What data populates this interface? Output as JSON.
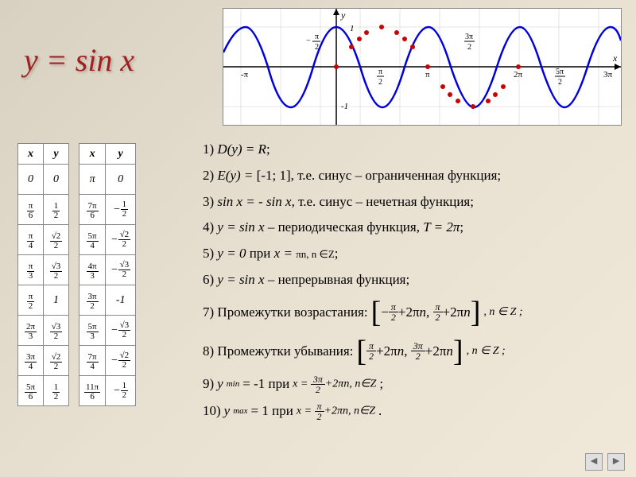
{
  "title": "y = sin x",
  "graph": {
    "xlabel": "x",
    "ylabel": "y",
    "y_ticks": [
      "1",
      "-1"
    ],
    "x_ticks": [
      "-π",
      "−π/2",
      "π/2",
      "π",
      "3π/2",
      "2π",
      "5π/2",
      "3π"
    ]
  },
  "table1": {
    "headers": [
      "x",
      "y"
    ],
    "rows": [
      {
        "x": "0",
        "y": "0"
      },
      {
        "x": "π/6",
        "y": "1/2"
      },
      {
        "x": "π/4",
        "y": "√2/2"
      },
      {
        "x": "π/3",
        "y": "√3/2"
      },
      {
        "x": "π/2",
        "y": "1"
      },
      {
        "x": "2π/3",
        "y": "√3/2"
      },
      {
        "x": "3π/4",
        "y": "√2/2"
      },
      {
        "x": "5π/6",
        "y": "1/2"
      }
    ]
  },
  "table2": {
    "headers": [
      "x",
      "y"
    ],
    "rows": [
      {
        "x": "π",
        "y": "0"
      },
      {
        "x": "7π/6",
        "y": "−1/2"
      },
      {
        "x": "5π/4",
        "y": "−√2/2"
      },
      {
        "x": "4π/3",
        "y": "−√3/2"
      },
      {
        "x": "3π/2",
        "y": "-1"
      },
      {
        "x": "5π/3",
        "y": "−√3/2"
      },
      {
        "x": "7π/4",
        "y": "−√2/2"
      },
      {
        "x": "11π/6",
        "y": "−1/2"
      }
    ]
  },
  "props": {
    "p1_a": "1) ",
    "p1_b": "D(y) = R",
    "p1_c": ";",
    "p2_a": "2) ",
    "p2_b": "E(y) = ",
    "p2_c": "[-1; 1], т.е. синус – ограниченная функция;",
    "p3_a": "3) ",
    "p3_b": "sin x = - sin x",
    "p3_c": ", т.е. синус – нечетная функция;",
    "p4_a": "4) ",
    "p4_b": "y = sin x",
    "p4_c": " – периодическая функция, ",
    "p4_d": "T = 2π",
    "p4_e": ";",
    "p5_a": "5) ",
    "p5_b": "y = 0",
    "p5_c": " при ",
    "p5_d": "x = ",
    "p5_e": "πn, n ∈Z",
    "p5_f": ";",
    "p6_a": "6) ",
    "p6_b": "y = sin x",
    "p6_c": " – непрерывная функция;",
    "p7_a": "7) Промежутки возрастания: ",
    "p7_int": {
      "a": "−π/2 + 2πn",
      "b": "π/2 + 2πn"
    },
    "p7_cond": ", n ∈ Z ;",
    "p8_a": "8) Промежутки убывания: ",
    "p8_int": {
      "a": "π/2 + 2πn",
      "b": "3π/2 + 2πn"
    },
    "p8_cond": ", n ∈ Z ;",
    "p9_a": "9) ",
    "p9_b": "y",
    "p9_sub": "min",
    "p9_c": "= -1 при ",
    "p9_eq": "x = 3π/2 + 2πn, n ∈ Z",
    "p9_d": " ;",
    "p10_a": "10) ",
    "p10_b": "y",
    "p10_sub": "max",
    "p10_c": "= 1 при ",
    "p10_eq": "x = π/2 + 2πn, n ∈ Z",
    "p10_d": " ."
  },
  "chart_data": {
    "type": "line",
    "title": "y = sin x",
    "xlabel": "x",
    "ylabel": "y",
    "xlim": [
      -3.6,
      10.0
    ],
    "ylim": [
      -1.3,
      1.3
    ],
    "series": [
      {
        "name": "sin x",
        "color": "#0000cc",
        "x": [
          -3.6,
          -3.14,
          -2.5,
          -1.57,
          -0.785,
          0,
          0.785,
          1.57,
          2.36,
          3.14,
          3.93,
          4.71,
          5.5,
          6.28,
          7.07,
          7.85,
          8.64,
          9.42,
          10.0
        ],
        "y": [
          0.44,
          0,
          -0.6,
          -1,
          -0.71,
          0,
          0.71,
          1,
          0.71,
          0,
          -0.71,
          -1,
          -0.71,
          0,
          0.71,
          1,
          0.71,
          0,
          -0.54
        ]
      }
    ],
    "points": {
      "color": "#cc0000",
      "x": [
        0,
        0.524,
        0.785,
        1.047,
        1.571,
        2.094,
        2.356,
        2.618,
        3.142,
        3.665,
        3.927,
        4.189,
        4.712,
        5.236,
        5.498,
        5.76,
        6.283
      ],
      "y": [
        0,
        0.5,
        0.707,
        0.866,
        1,
        0.866,
        0.707,
        0.5,
        0,
        -0.5,
        -0.707,
        -0.866,
        -1,
        -0.866,
        -0.707,
        -0.5,
        0
      ]
    }
  }
}
